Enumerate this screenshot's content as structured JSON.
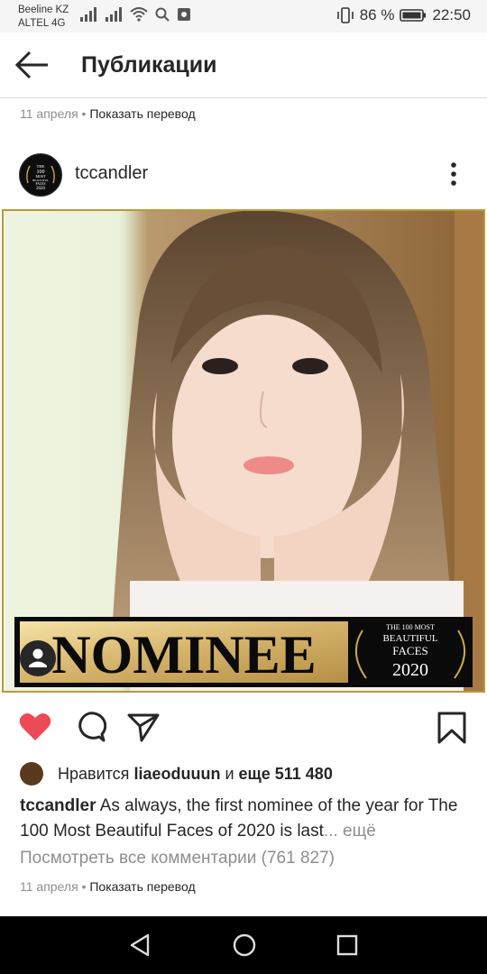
{
  "status": {
    "carrier1": "Beeline KZ",
    "carrier2": "ALTEL 4G",
    "battery": "86 %",
    "time": "22:50"
  },
  "header": {
    "title": "Публикации"
  },
  "prev_post": {
    "date": "11 апреля",
    "translate": "Показать перевод"
  },
  "post": {
    "username": "tccandler",
    "avatar_text": [
      "THE",
      "100",
      "MOST",
      "BEAUTIFUL",
      "FACES",
      "2020"
    ],
    "banner": {
      "word": "NOMINEE",
      "badge_line1": "THE 100 MOST",
      "badge_line2": "BEAUTIFUL",
      "badge_line3": "FACES",
      "badge_year": "2020"
    },
    "likes_prefix": "Нравится",
    "likes_user": "liaeoduuun",
    "likes_and": "и",
    "likes_count": "еще 511 480",
    "caption_user": "tccandler",
    "caption_text": "As always, the first nominee of the year for The 100 Most Beautiful Faces of 2020 is last",
    "caption_more": "... ещё",
    "view_comments": "Посмотреть все комментарии (761 827)",
    "date": "11 апреля",
    "translate": "Показать перевод"
  },
  "colors": {
    "like": "#ed4956",
    "text": "#262626",
    "secondary": "#8e8e8e",
    "gold": "#b89a3a"
  },
  "icons": [
    "back-arrow-icon",
    "more-vertical-icon",
    "heart-icon",
    "comment-icon",
    "share-icon",
    "bookmark-icon",
    "user-tag-icon",
    "nav-back-icon",
    "nav-home-icon",
    "nav-recents-icon"
  ]
}
